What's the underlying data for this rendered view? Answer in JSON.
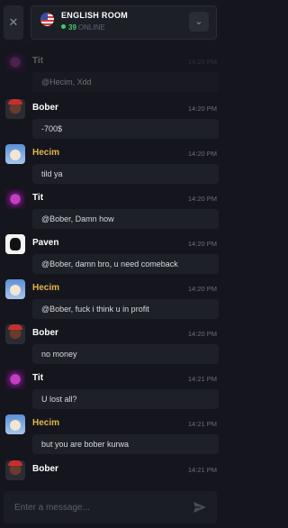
{
  "header": {
    "close_glyph": "✕",
    "room_title": "ENGLISH ROOM",
    "online_count": "39",
    "online_label": "ONLINE",
    "flag_icon": "us-flag-icon",
    "dropdown_glyph": "⌄"
  },
  "messages": [
    {
      "user": "Tit",
      "time": "14:20 PM",
      "text": "@Hecim, Xdd",
      "avatar": "tit",
      "name_color": "white"
    },
    {
      "user": "Bober",
      "time": "14:20 PM",
      "text": "-700$",
      "avatar": "bober",
      "name_color": "white"
    },
    {
      "user": "Hecim",
      "time": "14:20 PM",
      "text": "tild ya",
      "avatar": "hecim",
      "name_color": "gold"
    },
    {
      "user": "Tit",
      "time": "14:20 PM",
      "text": "@Bober, Damn how",
      "avatar": "tit",
      "name_color": "white"
    },
    {
      "user": "Paven",
      "time": "14:20 PM",
      "text": "@Bober, damn bro, u need comeback",
      "avatar": "paven",
      "name_color": "white"
    },
    {
      "user": "Hecim",
      "time": "14:20 PM",
      "text": "@Bober, fuck i think u in profit",
      "avatar": "hecim",
      "name_color": "gold"
    },
    {
      "user": "Bober",
      "time": "14:20 PM",
      "text": "no money",
      "avatar": "bober",
      "name_color": "white"
    },
    {
      "user": "Tit",
      "time": "14:21 PM",
      "text": "U lost all?",
      "avatar": "tit",
      "name_color": "white"
    },
    {
      "user": "Hecim",
      "time": "14:21 PM",
      "text": "but you are bober kurwa",
      "avatar": "hecim",
      "name_color": "gold"
    },
    {
      "user": "Bober",
      "time": "14:21 PM",
      "text": "",
      "avatar": "bober",
      "name_color": "white"
    }
  ],
  "composer": {
    "placeholder": "Enter a message...",
    "value": "",
    "send_icon": "send-icon"
  },
  "colors": {
    "background": "#15161d",
    "bubble": "#1e2028",
    "gold_name": "#e4b54a",
    "online_green": "#3ccf6a"
  }
}
